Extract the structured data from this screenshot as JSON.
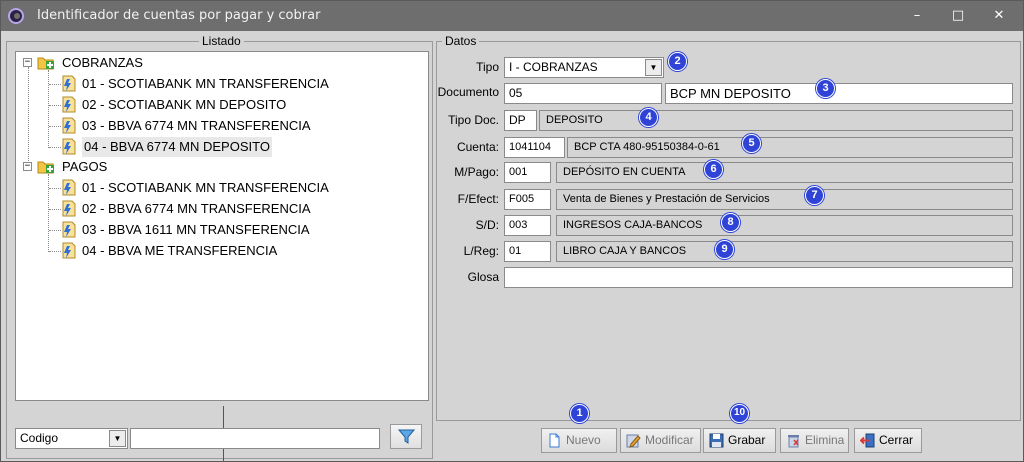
{
  "window": {
    "title": "Identificador de cuentas por pagar y cobrar",
    "minimize": "–",
    "maximize": "□",
    "close": "✕"
  },
  "listado": {
    "title": "Listado",
    "groups": [
      {
        "label": "COBRANZAS",
        "expander": "−",
        "items": [
          "01 - SCOTIABANK MN TRANSFERENCIA",
          "02 - SCOTIABANK MN DEPOSITO",
          "03 - BBVA 6774 MN TRANSFERENCIA",
          "04 - BBVA 6774 MN DEPOSITO"
        ]
      },
      {
        "label": "PAGOS",
        "expander": "−",
        "items": [
          "01 - SCOTIABANK MN TRANSFERENCIA",
          "02 - BBVA 6774 MN TRANSFERENCIA",
          "03 - BBVA 1611 MN TRANSFERENCIA",
          "04 - BBVA ME TRANSFERENCIA"
        ]
      }
    ],
    "selected": "04 - BBVA 6774 MN DEPOSITO",
    "search_field": "Codigo",
    "search_value": "",
    "filter_icon": "funnel-icon"
  },
  "datos": {
    "title": "Datos",
    "tipo": {
      "label": "Tipo",
      "value": "I - COBRANZAS"
    },
    "documento": {
      "label": "Documento",
      "code": "05",
      "desc": "BCP MN DEPOSITO"
    },
    "tipo_doc": {
      "label": "Tipo Doc.",
      "code": "DP",
      "desc": "DEPOSITO"
    },
    "cuenta": {
      "label": "Cuenta:",
      "code": "1041104",
      "desc": "BCP CTA 480-95150384-0-61"
    },
    "m_pago": {
      "label": "M/Pago:",
      "code": "001",
      "desc": "DEPÓSITO EN CUENTA"
    },
    "f_efect": {
      "label": "F/Efect:",
      "code": "F005",
      "desc": "Venta de Bienes y Prestación de Servicios"
    },
    "s_d": {
      "label": "S/D:",
      "code": "003",
      "desc": "INGRESOS CAJA-BANCOS"
    },
    "l_reg": {
      "label": "L/Reg:",
      "code": "01",
      "desc": "LIBRO CAJA Y BANCOS"
    },
    "glosa": {
      "label": "Glosa",
      "value": ""
    }
  },
  "badges": [
    "1",
    "2",
    "3",
    "4",
    "5",
    "6",
    "7",
    "8",
    "9",
    "10"
  ],
  "buttons": {
    "nuevo": "Nuevo",
    "modificar": "Modificar",
    "grabar": "Grabar",
    "elimina": "Elimina",
    "cerrar": "Cerrar"
  },
  "colors": {
    "badge": "#2f44d6",
    "titlebar": "#6e6e6e",
    "window": "#d4d4d4"
  }
}
